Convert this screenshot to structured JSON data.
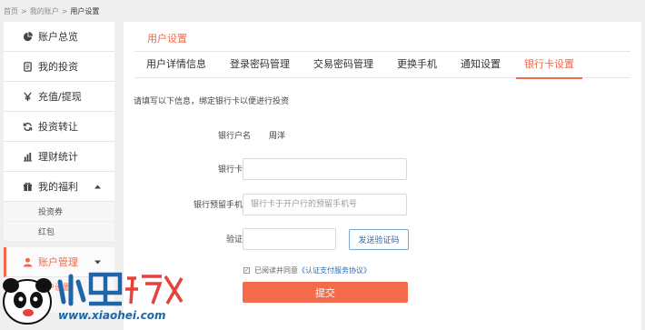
{
  "breadcrumb": {
    "items": [
      "首页",
      "我的账户",
      "用户设置"
    ],
    "sep": ">"
  },
  "sidebar": {
    "items": [
      {
        "label": "账户总览",
        "icon": "pie-chart-icon"
      },
      {
        "label": "我的投资",
        "icon": "document-icon"
      },
      {
        "label": "充值/提现",
        "icon": "yen-icon"
      },
      {
        "label": "投资转让",
        "icon": "refresh-icon"
      },
      {
        "label": "理财统计",
        "icon": "bar-chart-icon"
      },
      {
        "label": "我的福利",
        "icon": "gift-icon"
      },
      {
        "label": "账户管理",
        "icon": "user-icon"
      }
    ],
    "welfare_sub": [
      "投资券",
      "红包"
    ],
    "account_sub": [
      "用户设置"
    ]
  },
  "panel": {
    "title": "用户设置"
  },
  "tabs": [
    "用户详情信息",
    "登录密码管理",
    "交易密码管理",
    "更换手机",
    "通知设置",
    "银行卡设置"
  ],
  "form": {
    "intro": "请填写以下信息，绑定银行卡以便进行投资",
    "account_name_label": "银行户名",
    "account_name_value": "周洋",
    "card_no_label": "银行卡号",
    "card_no_value": "",
    "phone_label": "银行预留手机号",
    "phone_placeholder": "银行卡于开户行的预留手机号",
    "code_label": "验证码",
    "code_value": "",
    "send_code": "发送验证码",
    "agree_text": "已阅读并同意",
    "agree_link": "《认证支付服务协议》",
    "submit": "提交"
  },
  "watermark": {
    "text": "www.xiaohei.com",
    "chars": "小黑游戏"
  },
  "colors": {
    "accent": "#f06a4a",
    "link": "#2f6ab7"
  }
}
